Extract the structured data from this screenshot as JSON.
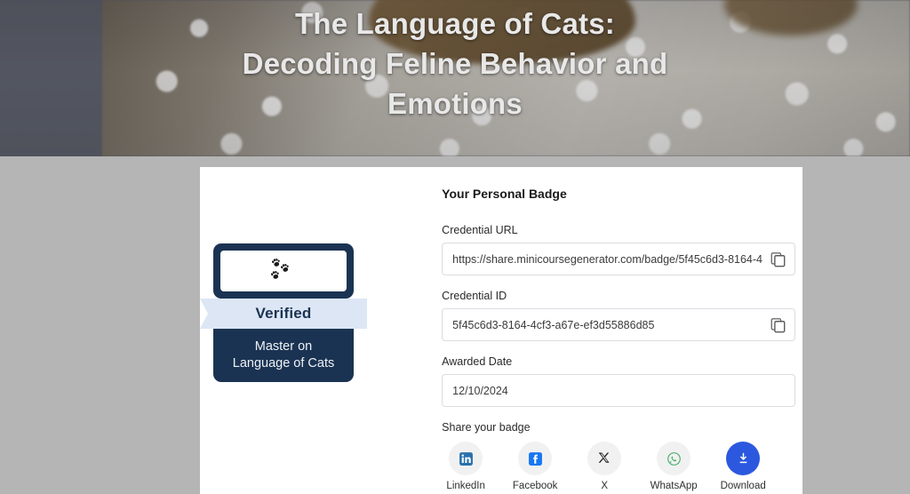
{
  "hero": {
    "title_lines": [
      "The Language of Cats:",
      "Decoding Feline Behavior and",
      "Emotions"
    ],
    "title_full": "The Language of Cats: Decoding Feline Behavior and Emotions",
    "background_color": "#5a5e69"
  },
  "badge": {
    "emblem_icon": "cat-paw-prints-icon",
    "ribbon_label": "Verified",
    "title": "Master on\nLanguage of Cats",
    "title_line_1": "Master on",
    "title_line_2": "Language of Cats",
    "navy_color": "#1b3352",
    "ribbon_color": "#dce6f5"
  },
  "details": {
    "pane_title": "Your Personal Badge",
    "fields": [
      {
        "label": "Credential URL",
        "value": "https://share.minicoursegenerator.com/badge/5f45c6d3-8164-4",
        "copyable": true,
        "copy_icon": "copy-icon"
      },
      {
        "label": "Credential ID",
        "value": "5f45c6d3-8164-4cf3-a67e-ef3d55886d85",
        "copyable": true,
        "copy_icon": "copy-icon"
      },
      {
        "label": "Awarded Date",
        "value": "12/10/2024",
        "copyable": false,
        "copy_icon": ""
      }
    ],
    "share_label": "Share your badge",
    "share_items": [
      {
        "name": "LinkedIn",
        "icon": "linkedin-icon",
        "color": "#2a71ac",
        "accent": false
      },
      {
        "name": "Facebook",
        "icon": "facebook-icon",
        "color": "#1877f2",
        "accent": false
      },
      {
        "name": "X",
        "icon": "x-twitter-icon",
        "color": "#1b1b1b",
        "accent": false
      },
      {
        "name": "WhatsApp",
        "icon": "whatsapp-icon",
        "color": "#4caf6d",
        "accent": false
      },
      {
        "name": "Download",
        "icon": "download-icon",
        "color": "#ffffff",
        "accent": true
      }
    ],
    "accent_color": "#2b58de"
  },
  "page": {
    "background_color": "#b5b5b5",
    "card_background": "#ffffff"
  }
}
